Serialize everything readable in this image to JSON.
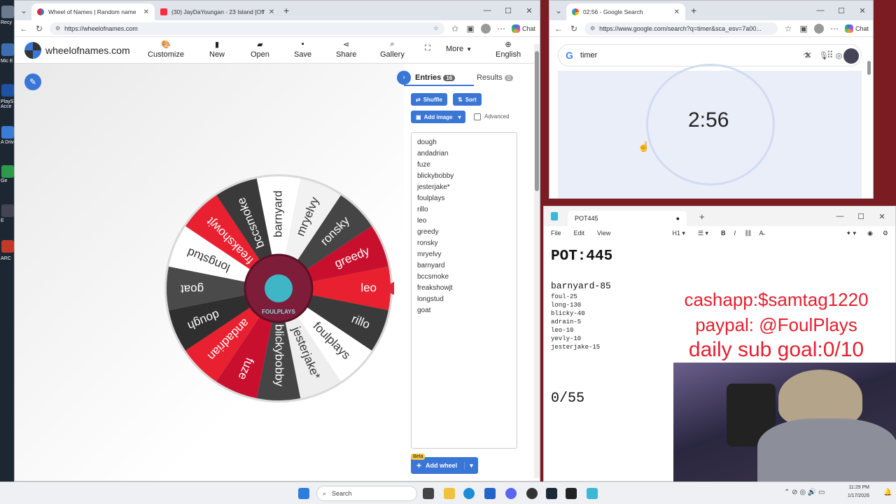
{
  "desktop": {
    "labels": [
      "Recy",
      "Mic E",
      "PlayS Acce",
      "A Driv",
      "Ge",
      "E",
      "ARC"
    ]
  },
  "left_browser": {
    "tabs": [
      {
        "label": "Wheel of Names | Random name",
        "active": true
      },
      {
        "label": "(30) JayDaYoungan - 23 Island [Off",
        "active": false
      }
    ],
    "url": "https://wheelofnames.com",
    "chat_label": "Chat",
    "brand": "wheelofnames.com",
    "menu": [
      {
        "icon": "palette",
        "label": "Customize"
      },
      {
        "icon": "file",
        "label": "New"
      },
      {
        "icon": "folder-open",
        "label": "Open"
      },
      {
        "icon": "save",
        "label": "Save"
      },
      {
        "icon": "share",
        "label": "Share"
      },
      {
        "icon": "search",
        "label": "Gallery"
      },
      {
        "icon": "fullscreen",
        "label": ""
      },
      {
        "icon": "",
        "label": "More"
      },
      {
        "icon": "globe",
        "label": "English"
      }
    ],
    "sidebar": {
      "entries_tab": "Entries",
      "entries_count": "16",
      "results_tab": "Results",
      "results_count": "0",
      "shuffle": "Shuffle",
      "sort": "Sort",
      "add_image": "Add image",
      "advanced": "Advanced",
      "add_wheel": "Add wheel",
      "beta": "Beta"
    },
    "entries": [
      "dough",
      "andadrian",
      "fuze",
      "blickybobby",
      "jesterjake*",
      "foulplays",
      "rillo",
      "leo",
      "greedy",
      "ronsky",
      "mryelvy",
      "barnyard",
      "bccsmoke",
      "freakshowjt",
      "longstud",
      "goat"
    ],
    "wheel": {
      "center_text": "FOULPLAYS",
      "pointer_color": "#e02437",
      "slice_colors": [
        "#ffffff",
        "#2f2f2f",
        "#e8202f",
        "#eeeeee",
        "#454545",
        "#c8102e"
      ]
    }
  },
  "right_browser": {
    "tab": "02:56 - Google Search",
    "url": "https://www.google.com/search?q=timer&sca_esv=7a00...",
    "chat_label": "Chat",
    "query": "timer",
    "timer": "2:56"
  },
  "notepad": {
    "tab": "POT445",
    "menu": [
      "File",
      "Edit",
      "View"
    ],
    "heading": "H1",
    "pot": "POT:445",
    "first_line": "barnyard-85",
    "lines": [
      "foul-25",
      "long-130",
      "blicky-40",
      "adrain-5",
      "leo-10",
      "yevly-10",
      "jesterjake-15"
    ],
    "count": "0/55"
  },
  "overlay": {
    "cashapp": "cashapp:$samtag1220",
    "paypal": "paypal: @FoulPlays",
    "goal": "daily sub goal:0/10",
    "color": "#e3202f"
  },
  "taskbar": {
    "search": "Search",
    "time": "11:29 PM",
    "date": "1/17/2026"
  }
}
